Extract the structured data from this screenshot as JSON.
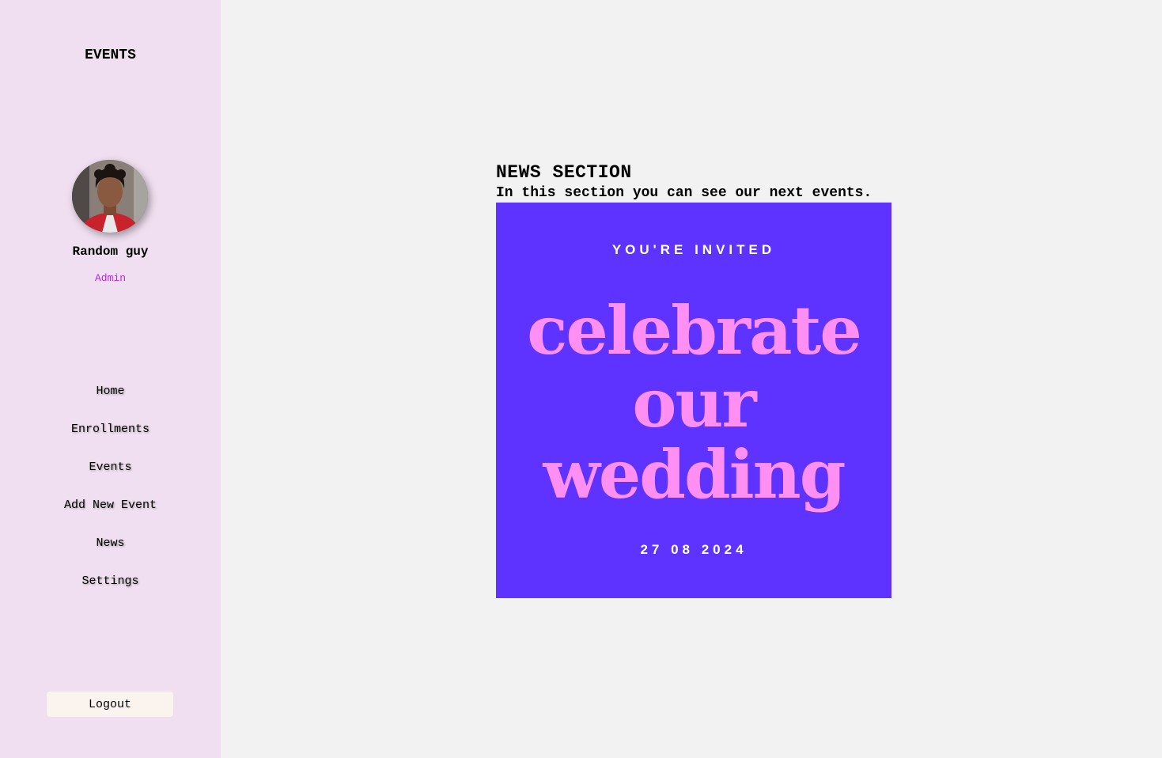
{
  "sidebar": {
    "brand": "EVENTS",
    "user": {
      "name": "Random guy",
      "role": "Admin"
    },
    "nav": [
      {
        "label": "Home"
      },
      {
        "label": "Enrollments"
      },
      {
        "label": "Events"
      },
      {
        "label": "Add New Event"
      },
      {
        "label": "News"
      },
      {
        "label": "Settings"
      }
    ],
    "logout_label": "Logout"
  },
  "main": {
    "title": "NEWS SECTION",
    "subtitle": "In this section you can see our next events.",
    "news_card": {
      "kicker": "YOU'RE INVITED",
      "headline_lines": [
        "celebrate",
        "our",
        "wedding"
      ],
      "date": "27 08 2024",
      "background_color": "#5f33ff",
      "headline_color": "#ff8ff2"
    }
  },
  "colors": {
    "sidebar_bg": "#f0dff0",
    "page_bg": "#f2f2f2",
    "role_accent": "#c020e8"
  }
}
